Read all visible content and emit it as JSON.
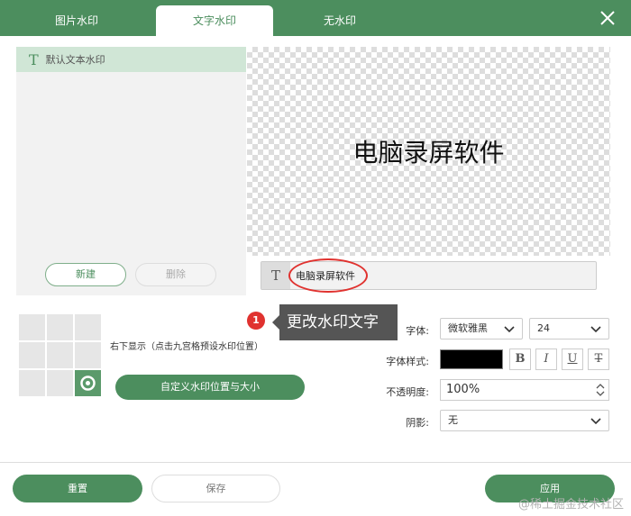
{
  "tabs": [
    {
      "label": "图片水印"
    },
    {
      "label": "文字水印"
    },
    {
      "label": "无水印"
    }
  ],
  "watermark_list": {
    "item_icon": "T",
    "item_label": "默认文本水印"
  },
  "left_buttons": {
    "new_label": "新建",
    "delete_label": "删除"
  },
  "preview": {
    "text": "电脑录屏软件"
  },
  "text_input": {
    "icon": "T",
    "value": "电脑录屏软件"
  },
  "annotation": {
    "badge": "1",
    "tooltip": "更改水印文字",
    "highlight_color": "#e0322f"
  },
  "position": {
    "text": "右下显示（点击九宫格预设水印位置）",
    "custom_button": "自定义水印位置与大小"
  },
  "font": {
    "font_label": "字体:",
    "font_value": "微软雅黑",
    "size_value": "24",
    "style_label": "字体样式:",
    "color": "#000000",
    "style_buttons": [
      "B",
      "I",
      "U",
      "T"
    ],
    "opacity_label": "不透明度:",
    "opacity_value": "100%",
    "shadow_label": "阴影:",
    "shadow_value": "无"
  },
  "footer": {
    "reset": "重置",
    "save": "保存",
    "apply": "应用"
  },
  "site_watermark": "@稀土掘金技术社区",
  "colors": {
    "accent": "#4c8e5e"
  }
}
